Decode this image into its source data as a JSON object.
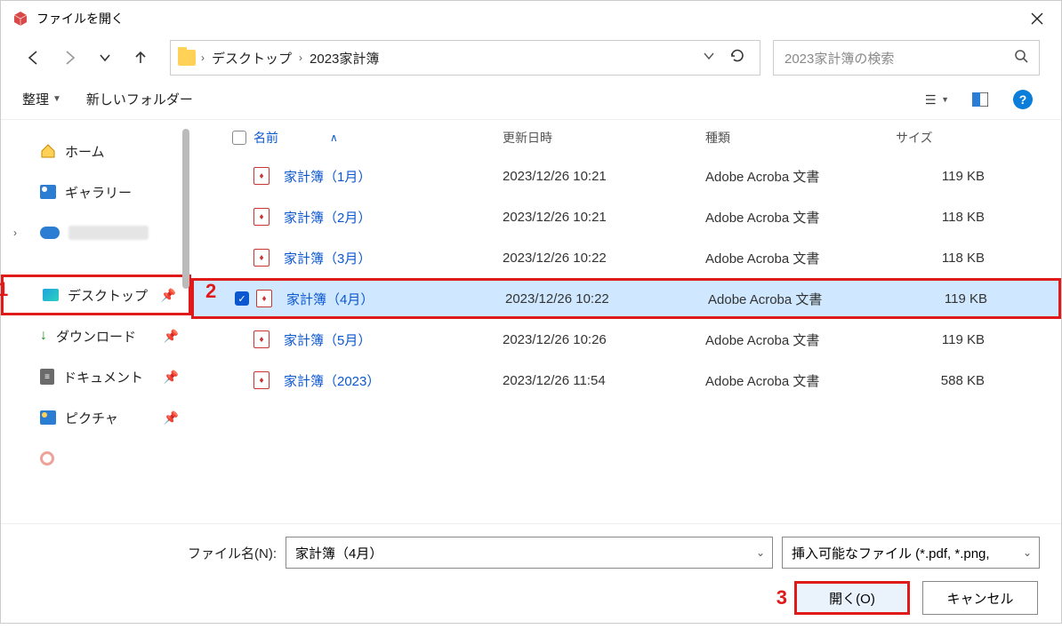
{
  "title": "ファイルを開く",
  "breadcrumb": {
    "items": [
      "デスクトップ",
      "2023家計簿"
    ]
  },
  "search": {
    "placeholder": "2023家計簿の検索"
  },
  "toolbar": {
    "organize": "整理",
    "newfolder": "新しいフォルダー"
  },
  "sidebar": {
    "home": "ホーム",
    "gallery": "ギャラリー",
    "desktop": "デスクトップ",
    "downloads": "ダウンロード",
    "documents": "ドキュメント",
    "pictures": "ピクチャ"
  },
  "columns": {
    "name": "名前",
    "date": "更新日時",
    "type": "種類",
    "size": "サイズ"
  },
  "files": [
    {
      "name": "家計簿（1月）",
      "date": "2023/12/26 10:21",
      "type": "Adobe Acroba 文書",
      "size": "119 KB"
    },
    {
      "name": "家計簿（2月）",
      "date": "2023/12/26 10:21",
      "type": "Adobe Acroba 文書",
      "size": "118 KB"
    },
    {
      "name": "家計簿（3月）",
      "date": "2023/12/26 10:22",
      "type": "Adobe Acroba 文書",
      "size": "118 KB"
    },
    {
      "name": "家計簿（4月）",
      "date": "2023/12/26 10:22",
      "type": "Adobe Acroba 文書",
      "size": "119 KB"
    },
    {
      "name": "家計簿（5月）",
      "date": "2023/12/26 10:26",
      "type": "Adobe Acroba 文書",
      "size": "119 KB"
    },
    {
      "name": "家計簿（2023）",
      "date": "2023/12/26 11:54",
      "type": "Adobe Acroba 文書",
      "size": "588 KB"
    }
  ],
  "bottom": {
    "filename_label": "ファイル名(N):",
    "filename_value": "家計簿（4月）",
    "filter": "挿入可能なファイル (*.pdf, *.png,",
    "open": "開く(O)",
    "cancel": "キャンセル"
  },
  "annotations": {
    "a1": "1",
    "a2": "2",
    "a3": "3"
  }
}
